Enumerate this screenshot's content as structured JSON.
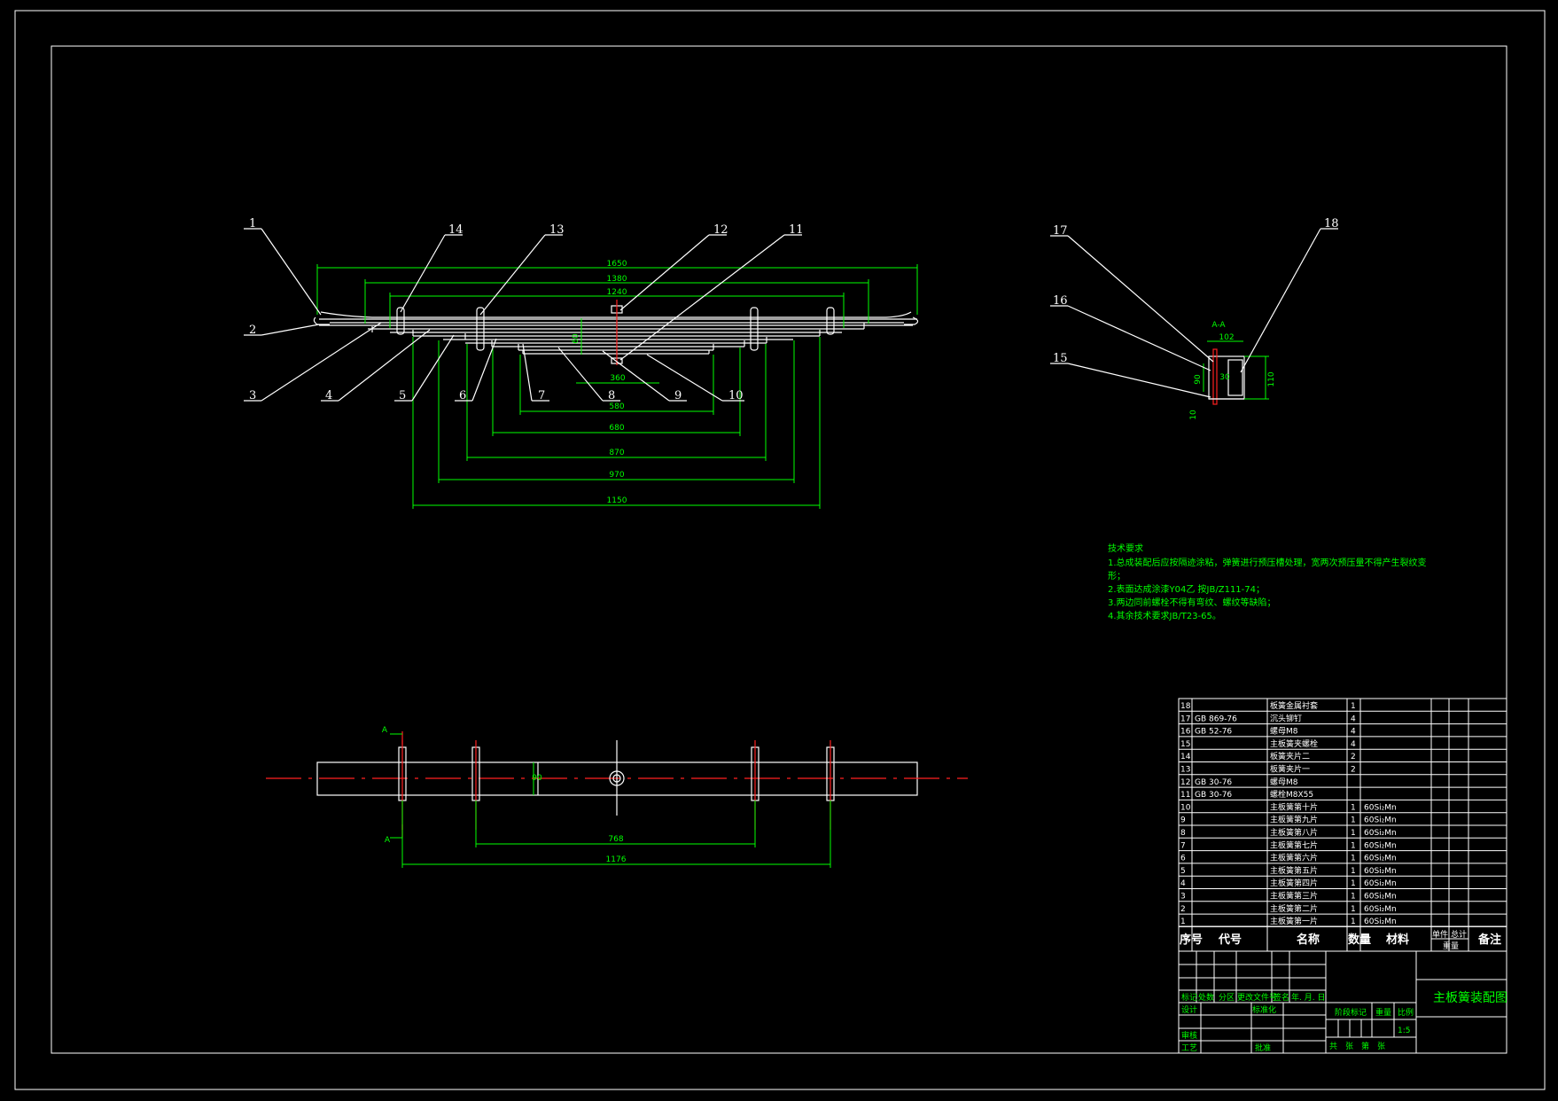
{
  "main_view": {
    "dims": [
      "1650",
      "1380",
      "1240",
      "580",
      "680",
      "870",
      "970",
      "1150",
      "360",
      "20"
    ],
    "dim_small": "60"
  },
  "balloons": [
    "1",
    "2",
    "3",
    "4",
    "5",
    "6",
    "7",
    "8",
    "9",
    "10",
    "11",
    "12",
    "13",
    "14"
  ],
  "section_view": {
    "title": "A-A",
    "balloons": [
      "17",
      "16",
      "15",
      "18"
    ],
    "dims": [
      "102",
      "90",
      "110",
      "10",
      "30"
    ]
  },
  "plan_view": {
    "dims": [
      "768",
      "1176"
    ],
    "dim_small": "90",
    "section_marks": [
      "A",
      "A"
    ]
  },
  "notes": {
    "title": "技术要求",
    "lines": [
      "1.总成装配后应按隔迹涂粘，弹簧进行预压槽处理，宽两次预压量不得产生裂纹变",
      "形；",
      "2.表面达成涂漆Y04乙 按JB/Z111-74；",
      "3.两边同前螺栓不得有弯纹、螺纹等缺陷；",
      "4.其余技术要求JB/T23-65。"
    ]
  },
  "bom": {
    "rows": [
      {
        "no": "18",
        "code": "",
        "name": "板簧金属衬套",
        "qty": "1",
        "mat": ""
      },
      {
        "no": "17",
        "code": "GB 869-76",
        "name": "沉头铆钉",
        "qty": "4",
        "mat": ""
      },
      {
        "no": "16",
        "code": "GB 52-76",
        "name": "螺母M8",
        "qty": "4",
        "mat": ""
      },
      {
        "no": "15",
        "code": "",
        "name": "主板簧夹螺栓",
        "qty": "4",
        "mat": ""
      },
      {
        "no": "14",
        "code": "",
        "name": "板簧夹片二",
        "qty": "2",
        "mat": ""
      },
      {
        "no": "13",
        "code": "",
        "name": "板簧夹片一",
        "qty": "2",
        "mat": ""
      },
      {
        "no": "12",
        "code": "GB 30-76",
        "name": "螺母M8",
        "qty": "",
        "mat": ""
      },
      {
        "no": "11",
        "code": "GB 30-76",
        "name": "螺栓M8X55",
        "qty": "",
        "mat": ""
      },
      {
        "no": "10",
        "code": "",
        "name": "主板簧第十片",
        "qty": "1",
        "mat": "60Si₂Mn"
      },
      {
        "no": "9",
        "code": "",
        "name": "主板簧第九片",
        "qty": "1",
        "mat": "60Si₂Mn"
      },
      {
        "no": "8",
        "code": "",
        "name": "主板簧第八片",
        "qty": "1",
        "mat": "60Si₂Mn"
      },
      {
        "no": "7",
        "code": "",
        "name": "主板簧第七片",
        "qty": "1",
        "mat": "60Si₂Mn"
      },
      {
        "no": "6",
        "code": "",
        "name": "主板簧第六片",
        "qty": "1",
        "mat": "60Si₂Mn"
      },
      {
        "no": "5",
        "code": "",
        "name": "主板簧第五片",
        "qty": "1",
        "mat": "60Si₂Mn"
      },
      {
        "no": "4",
        "code": "",
        "name": "主板簧第四片",
        "qty": "1",
        "mat": "60Si₂Mn"
      },
      {
        "no": "3",
        "code": "",
        "name": "主板簧第三片",
        "qty": "1",
        "mat": "60Si₂Mn"
      },
      {
        "no": "2",
        "code": "",
        "name": "主板簧第二片",
        "qty": "1",
        "mat": "60Si₂Mn"
      },
      {
        "no": "1",
        "code": "",
        "name": "主板簧第一片",
        "qty": "1",
        "mat": "60Si₂Mn"
      }
    ],
    "header": {
      "no": "序号",
      "code": "代号",
      "name": "名称",
      "qty": "数量",
      "mat": "材料",
      "unit": "单件",
      "total": "总计",
      "weight": "重量",
      "remark": "备注"
    }
  },
  "title_block": {
    "drawing_title": "主板簧装配图",
    "scale_label": "比例",
    "scale_value": "1:5",
    "stage_label": "阶段标记",
    "mass_label": "重量",
    "sheet_text": "共　张　第　张",
    "row_labels": [
      "标记",
      "处数",
      "分区",
      "更改文件号",
      "签名",
      "年. 月. 日"
    ],
    "designer": "设计",
    "standard": "标准化",
    "checker": "审核",
    "process": "工艺",
    "approve": "批准"
  }
}
